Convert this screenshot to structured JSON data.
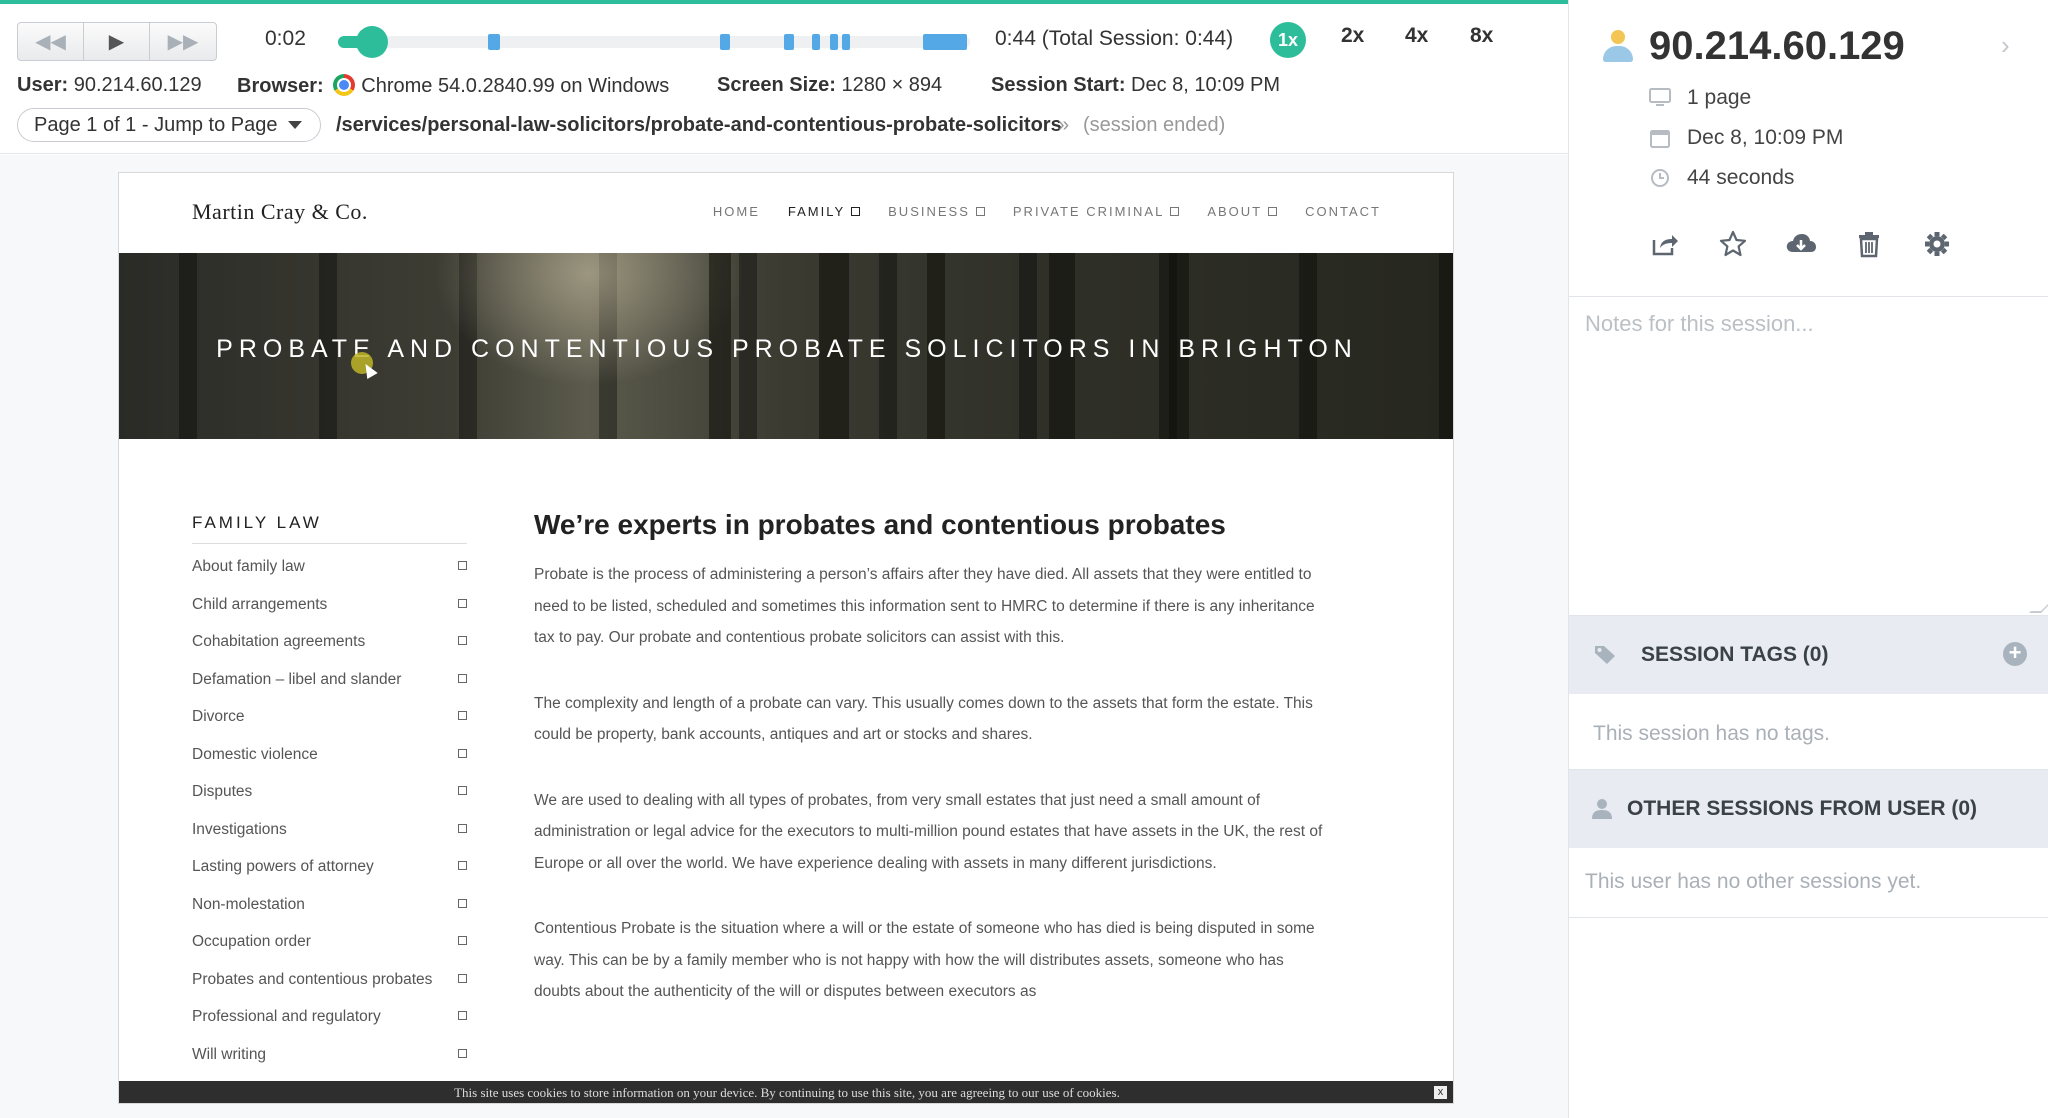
{
  "colors": {
    "accent": "#2ebd9a",
    "event_marker": "#55a8e6",
    "panel_section_bg": "#e8ecf2"
  },
  "player": {
    "controls": [
      {
        "name": "rewind",
        "icon": "rewind-icon",
        "glyph": "◀◀"
      },
      {
        "name": "play",
        "icon": "play-icon",
        "glyph": "▶"
      },
      {
        "name": "fast-forward",
        "icon": "fast-forward-icon",
        "glyph": "▶▶"
      }
    ],
    "current_time": "0:02",
    "total_time": "0:44 (Total Session: 0:44)",
    "progress_fraction": 0.045,
    "speeds": [
      "1x",
      "2x",
      "4x",
      "8x"
    ],
    "active_speed": "1x"
  },
  "session_meta": {
    "user_label": "User:",
    "user_value": "90.214.60.129",
    "browser_label": "Browser:",
    "browser_value": "Chrome 54.0.2840.99 on Windows",
    "screen_label": "Screen Size:",
    "screen_value": "1280 × 894",
    "start_label": "Session Start:",
    "start_value": "Dec 8, 10:09 PM"
  },
  "page_nav": {
    "jump_label": "Page 1 of 1 - Jump to Page",
    "url": "/services/personal-law-solicitors/probate-and-contentious-probate-solicitors",
    "separator": "»",
    "status": "(session ended)"
  },
  "site": {
    "logo": "Martin Cray & Co.",
    "nav": [
      {
        "label": "HOME",
        "has_sub": false,
        "active": false
      },
      {
        "label": "FAMILY",
        "has_sub": true,
        "active": true
      },
      {
        "label": "BUSINESS",
        "has_sub": true,
        "active": false
      },
      {
        "label": "PRIVATE CRIMINAL",
        "has_sub": true,
        "active": false
      },
      {
        "label": "ABOUT",
        "has_sub": true,
        "active": false
      },
      {
        "label": "CONTACT",
        "has_sub": false,
        "active": false
      }
    ],
    "hero_title": "PROBATE AND CONTENTIOUS PROBATE SOLICITORS IN BRIGHTON",
    "sidebar_heading": "FAMILY LAW",
    "sidebar_items": [
      "About family law",
      "Child arrangements",
      "Cohabitation agreements",
      "Defamation – libel and slander",
      "Divorce",
      "Domestic violence",
      "Disputes",
      "Investigations",
      "Lasting powers of attorney",
      "Non-molestation",
      "Occupation order",
      "Probates and contentious probates",
      "Professional and regulatory",
      "Will writing"
    ],
    "content_title": "We’re experts in probates and contentious probates",
    "paragraphs": [
      "Probate is the process of administering a person’s affairs after they have died. All assets that they were entitled to need to be listed, scheduled and sometimes this information sent to HMRC to determine if there is any inheritance tax to pay. Our probate and contentious probate solicitors can assist with this.",
      "The complexity and length of a probate can vary. This usually comes down to the assets that form the estate. This could be property, bank accounts, antiques and art or stocks and shares.",
      "We are used to dealing with all types of probates, from very small estates that just need a small amount of administration or legal advice for the executors to multi-million pound estates that have assets in the UK, the rest of Europe or all over the world. We have experience dealing with assets in many different jurisdictions.",
      "Contentious Probate is the situation where a will or the estate of someone who has died is being disputed in some way. This can be by a family member who is not happy with how the will distributes assets, someone who has doubts about the authenticity of the will or disputes between executors as"
    ],
    "cookie_text": "This site uses cookies to store information on your device. By continuing to use this site, you are agreeing to our use of cookies.",
    "cookie_close": "x"
  },
  "panel": {
    "ip": "90.214.60.129",
    "pages": "1 page",
    "date": "Dec 8, 10:09 PM",
    "duration": "44 seconds",
    "actions": [
      "share-icon",
      "star-icon",
      "download-icon",
      "trash-icon",
      "gear-icon"
    ],
    "notes_placeholder": "Notes for this session...",
    "tags_heading": "SESSION TAGS (0)",
    "tags_empty": "This session has no tags.",
    "other_heading": "OTHER SESSIONS FROM USER (0)",
    "other_empty": "This user has no other sessions yet."
  }
}
